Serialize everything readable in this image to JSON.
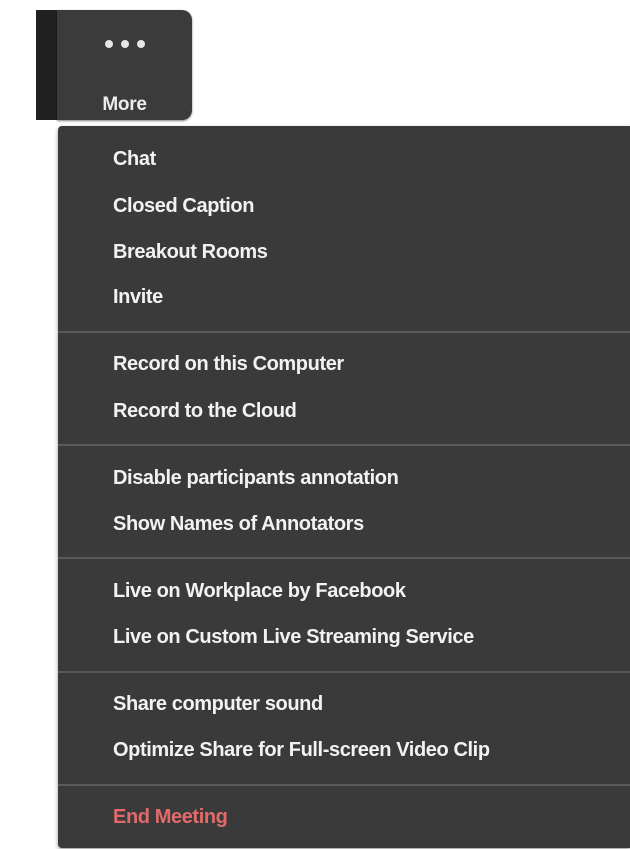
{
  "more_button": {
    "label": "More",
    "icon": "ellipsis-icon"
  },
  "menu": {
    "groups": [
      {
        "items": [
          {
            "label": "Chat"
          },
          {
            "label": "Closed Caption"
          },
          {
            "label": "Breakout Rooms"
          },
          {
            "label": "Invite"
          }
        ]
      },
      {
        "items": [
          {
            "label": "Record on this Computer"
          },
          {
            "label": "Record to the Cloud"
          }
        ]
      },
      {
        "items": [
          {
            "label": "Disable participants annotation"
          },
          {
            "label": "Show Names of Annotators"
          }
        ]
      },
      {
        "items": [
          {
            "label": "Live on Workplace by Facebook"
          },
          {
            "label": "Live on Custom Live Streaming Service"
          }
        ]
      },
      {
        "items": [
          {
            "label": "Share computer sound"
          },
          {
            "label": "Optimize Share for Full-screen Video Clip"
          }
        ]
      },
      {
        "items": [
          {
            "label": "End Meeting"
          }
        ]
      }
    ]
  },
  "colors": {
    "menu_background": "#3a3a3a",
    "menu_text": "#f2f2f2",
    "danger_text": "#e36a6a",
    "divider": "#5a5a5a"
  }
}
